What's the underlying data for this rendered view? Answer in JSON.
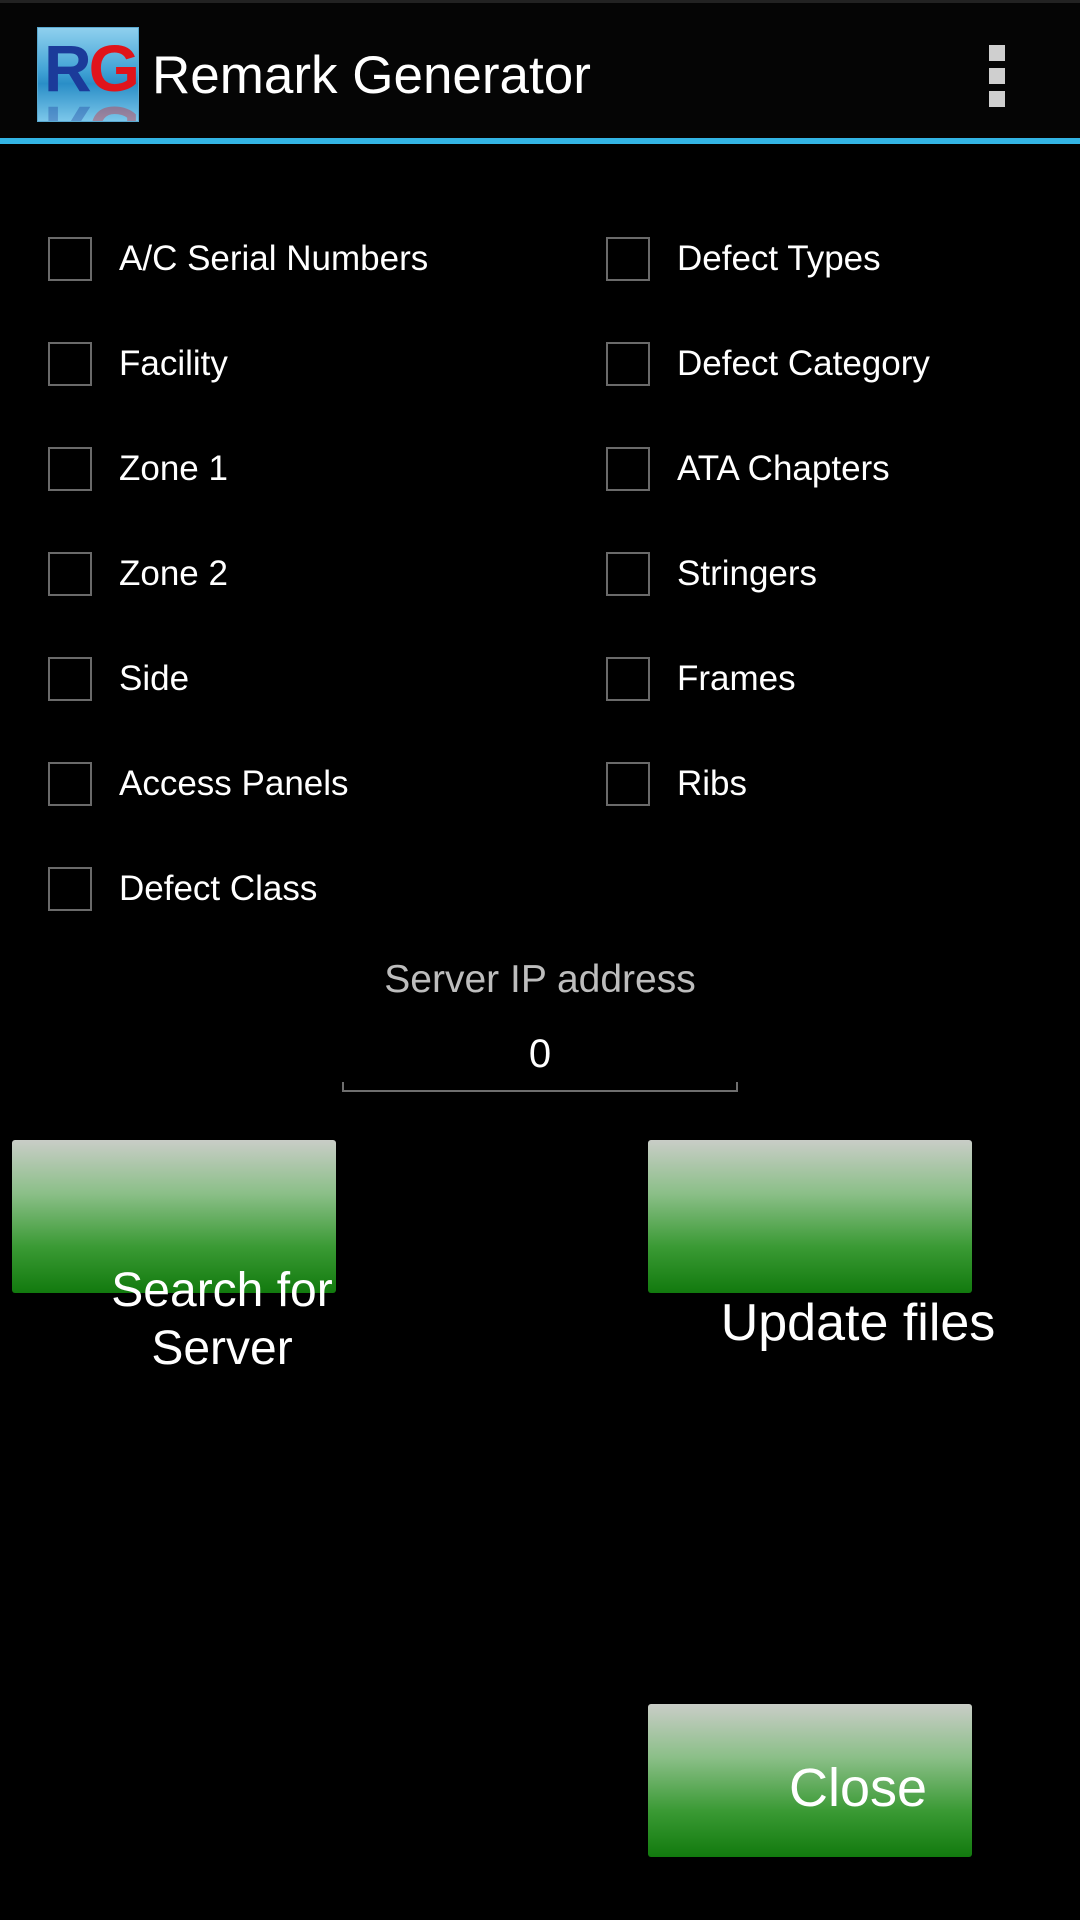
{
  "app": {
    "title": "Remark Generator",
    "icon_letters": {
      "r": "R",
      "g": "G"
    },
    "accent_color": "#33b5e5"
  },
  "checkboxes_left": [
    {
      "label": "A/C Serial Numbers",
      "checked": false
    },
    {
      "label": "Facility",
      "checked": false
    },
    {
      "label": "Zone 1",
      "checked": false
    },
    {
      "label": "Zone 2",
      "checked": false
    },
    {
      "label": "Side",
      "checked": false
    },
    {
      "label": "Access Panels",
      "checked": false
    },
    {
      "label": "Defect Class",
      "checked": false
    }
  ],
  "checkboxes_right": [
    {
      "label": "Defect Types",
      "checked": false
    },
    {
      "label": "Defect Category",
      "checked": false
    },
    {
      "label": "ATA Chapters",
      "checked": false
    },
    {
      "label": "Stringers",
      "checked": false
    },
    {
      "label": "Frames",
      "checked": false
    },
    {
      "label": "Ribs",
      "checked": false
    }
  ],
  "server": {
    "label": "Server IP address",
    "value": "0"
  },
  "buttons": {
    "search_line1": "Search for",
    "search_line2": "Server",
    "update": "Update files",
    "close": "Close",
    "color": "#127a0e"
  }
}
